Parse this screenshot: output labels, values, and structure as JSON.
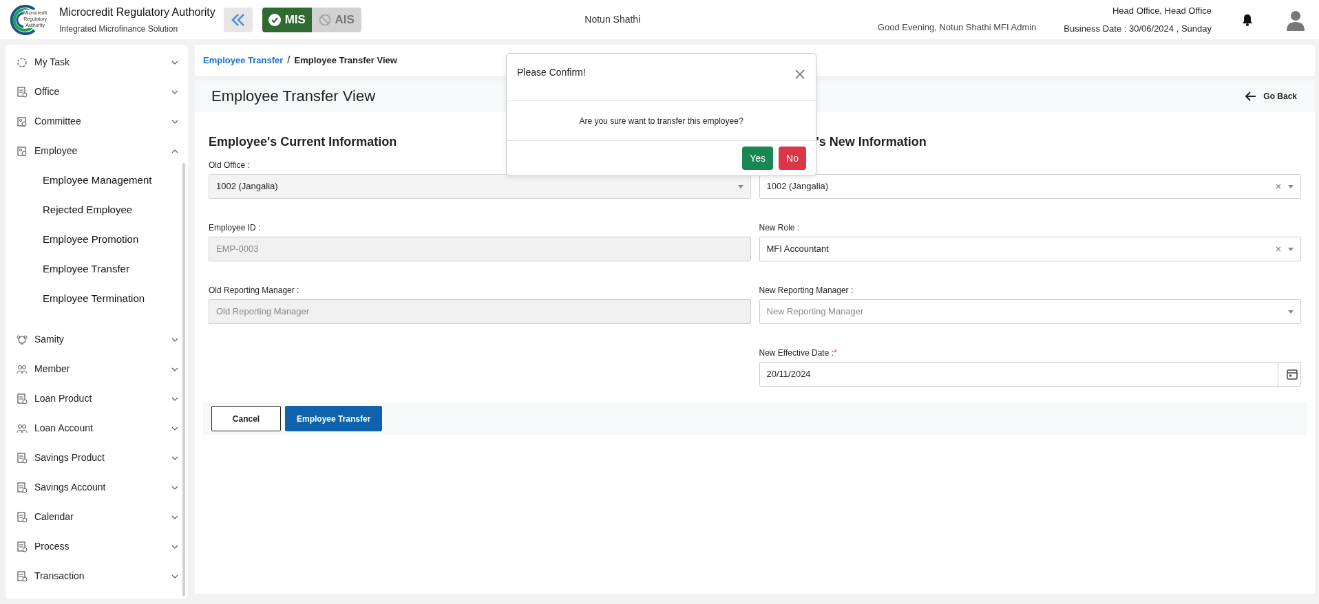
{
  "header": {
    "org_name": "Microcredit Regulatory Authority",
    "org_subtitle": "Integrated Microfinance Solution",
    "logo_text": [
      "Microcredit",
      "Regulatory",
      "Authority"
    ],
    "modules": [
      {
        "label": "MIS",
        "selected": true
      },
      {
        "label": "AIS",
        "selected": false
      }
    ],
    "center_title": "Notun Shathi",
    "greeting": "Good Evening, Notun Shathi MFI Admin",
    "office": "Head Office, Head Office",
    "business_date": "Business Date : 30/06/2024 , Sunday"
  },
  "sidebar": {
    "items": [
      {
        "label": "My Task",
        "expanded": false
      },
      {
        "label": "Office",
        "expanded": false
      },
      {
        "label": "Committee",
        "expanded": false
      },
      {
        "label": "Employee",
        "expanded": true,
        "children": [
          {
            "label": "Employee Management"
          },
          {
            "label": "Rejected Employee"
          },
          {
            "label": "Employee Promotion"
          },
          {
            "label": "Employee Transfer"
          },
          {
            "label": "Employee Termination"
          }
        ]
      },
      {
        "label": "Samity",
        "expanded": false
      },
      {
        "label": "Member",
        "expanded": false
      },
      {
        "label": "Loan Product",
        "expanded": false
      },
      {
        "label": "Loan Account",
        "expanded": false
      },
      {
        "label": "Savings Product",
        "expanded": false
      },
      {
        "label": "Savings Account",
        "expanded": false
      },
      {
        "label": "Calendar",
        "expanded": false
      },
      {
        "label": "Process",
        "expanded": false
      },
      {
        "label": "Transaction",
        "expanded": false
      }
    ]
  },
  "breadcrumb": [
    {
      "label": "Employee Transfer",
      "link": true
    },
    {
      "label": "Employee Transfer View",
      "link": false
    }
  ],
  "breadcrumb_separator": "/",
  "page_title": "Employee Transfer View",
  "back_label": "Go Back",
  "columns": [
    {
      "heading": "Employee's Current Information",
      "fields": [
        {
          "label": "Old Office :",
          "kind": "select",
          "value": "1002 (Jangalia)",
          "disabled": true,
          "clearable": false
        },
        {
          "label": "Employee ID :",
          "kind": "input",
          "value": "EMP-0003",
          "disabled": true
        },
        {
          "label": "Old Reporting Manager :",
          "kind": "input",
          "placeholder": "Old Reporting Manager",
          "disabled": true
        }
      ]
    },
    {
      "heading": "'s New Information",
      "fields": [
        {
          "kind": "select",
          "value": "1002 (Jangalia)",
          "disabled": false,
          "clearable": true
        },
        {
          "label": "New Role :",
          "kind": "select",
          "value": "MFI Accountant",
          "disabled": false,
          "clearable": true
        },
        {
          "label": "New Reporting Manager :",
          "kind": "select",
          "placeholder": "New Reporting Manager",
          "disabled": false,
          "clearable": false
        },
        {
          "label": "New Effective Date :",
          "required": true,
          "required_mark": "*",
          "kind": "date",
          "value": "20/11/2024",
          "disabled": false
        }
      ]
    }
  ],
  "actions": [
    {
      "label": "Cancel",
      "kind": "outline"
    },
    {
      "label": "Employee Transfer",
      "kind": "primary"
    }
  ],
  "dialog": {
    "title": "Please Confirm!",
    "message": "Are you sure want to transfer this employee?",
    "buttons": [
      {
        "label": "Yes",
        "kind": "success"
      },
      {
        "label": "No",
        "kind": "danger"
      }
    ]
  }
}
